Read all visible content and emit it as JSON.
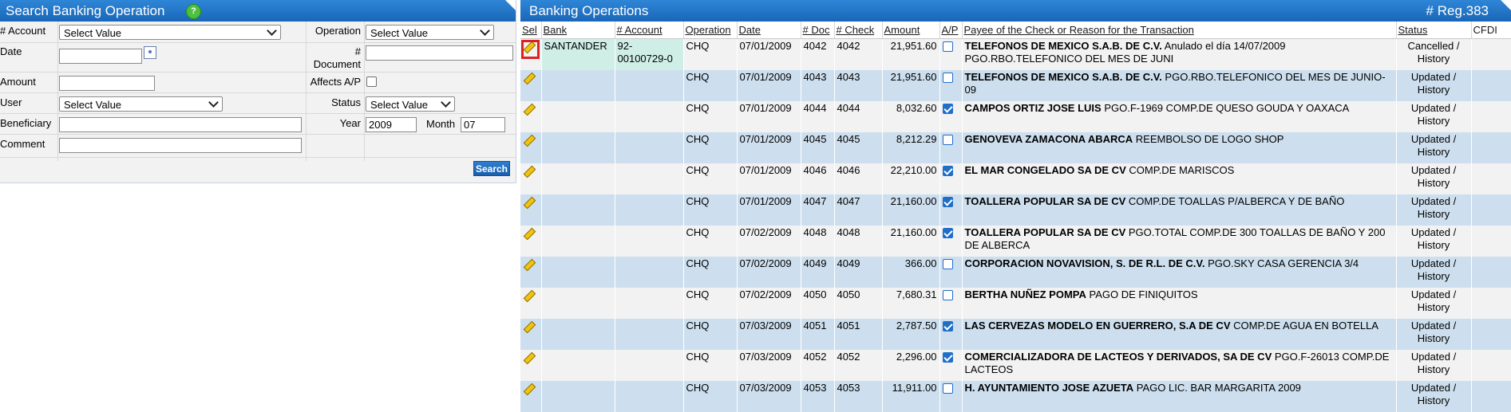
{
  "search": {
    "title": "Search Banking Operation",
    "help_icon": "?",
    "account_label": "# Account",
    "account_value": "Select Value",
    "operation_label": "Operation",
    "operation_value": "Select Value",
    "date_label": "Date",
    "document_label": "# Document",
    "amount_label": "Amount",
    "affects_label": "Affects A/P",
    "user_label": "User",
    "user_value": "Select Value",
    "status_label": "Status",
    "status_value": "Select Value",
    "beneficiary_label": "Beneficiary",
    "year_label": "Year",
    "year_value": "2009",
    "month_label": "Month",
    "month_value": "07",
    "comment_label": "Comment",
    "search_button": "Search"
  },
  "results": {
    "title": "Banking Operations",
    "reg_count": "# Reg.383",
    "columns": {
      "sel": "Sel",
      "bank": "Bank",
      "account": "# Account",
      "operation": "Operation",
      "date": "Date",
      "doc": "# Doc",
      "check": "# Check",
      "amount": "Amount",
      "ap": "A/P",
      "payee": "Payee of the Check or Reason for the Transaction",
      "status": "Status",
      "cfdi": "CFDI"
    },
    "rows": [
      {
        "bank": "SANTANDER",
        "account": "92-00100729-0",
        "operation": "CHQ",
        "date": "07/01/2009",
        "doc": "4042",
        "check": "4042",
        "amount": "21,951.60",
        "ap": false,
        "payee": "TELEFONOS DE MEXICO S.A.B. DE C.V.",
        "reason": "Anulado el día 14/07/2009 PGO.RBO.TELEFONICO DEL MES DE JUNI",
        "status": "Cancelled / History"
      },
      {
        "bank": "",
        "account": "",
        "operation": "CHQ",
        "date": "07/01/2009",
        "doc": "4043",
        "check": "4043",
        "amount": "21,951.60",
        "ap": false,
        "payee": "TELEFONOS DE MEXICO S.A.B. DE C.V.",
        "reason": "PGO.RBO.TELEFONICO DEL MES DE JUNIO-09",
        "status": "Updated / History"
      },
      {
        "bank": "",
        "account": "",
        "operation": "CHQ",
        "date": "07/01/2009",
        "doc": "4044",
        "check": "4044",
        "amount": "8,032.60",
        "ap": true,
        "payee": "CAMPOS ORTIZ JOSE LUIS",
        "reason": "PGO.F-1969 COMP.DE QUESO GOUDA Y OAXACA",
        "status": "Updated / History"
      },
      {
        "bank": "",
        "account": "",
        "operation": "CHQ",
        "date": "07/01/2009",
        "doc": "4045",
        "check": "4045",
        "amount": "8,212.29",
        "ap": false,
        "payee": "GENOVEVA ZAMACONA ABARCA",
        "reason": "REEMBOLSO DE LOGO SHOP",
        "status": "Updated / History"
      },
      {
        "bank": "",
        "account": "",
        "operation": "CHQ",
        "date": "07/01/2009",
        "doc": "4046",
        "check": "4046",
        "amount": "22,210.00",
        "ap": true,
        "payee": "EL MAR CONGELADO SA DE CV",
        "reason": "COMP.DE MARISCOS",
        "status": "Updated / History"
      },
      {
        "bank": "",
        "account": "",
        "operation": "CHQ",
        "date": "07/01/2009",
        "doc": "4047",
        "check": "4047",
        "amount": "21,160.00",
        "ap": true,
        "payee": "TOALLERA POPULAR SA DE CV",
        "reason": "COMP.DE TOALLAS P/ALBERCA Y DE BAÑO",
        "status": "Updated / History"
      },
      {
        "bank": "",
        "account": "",
        "operation": "CHQ",
        "date": "07/02/2009",
        "doc": "4048",
        "check": "4048",
        "amount": "21,160.00",
        "ap": true,
        "payee": "TOALLERA POPULAR SA DE CV",
        "reason": "PGO.TOTAL COMP.DE 300 TOALLAS DE BAÑO Y 200 DE ALBERCA",
        "status": "Updated / History"
      },
      {
        "bank": "",
        "account": "",
        "operation": "CHQ",
        "date": "07/02/2009",
        "doc": "4049",
        "check": "4049",
        "amount": "366.00",
        "ap": false,
        "payee": "CORPORACION NOVAVISION, S. DE R.L. DE C.V.",
        "reason": "PGO.SKY CASA GERENCIA 3/4",
        "status": "Updated / History"
      },
      {
        "bank": "",
        "account": "",
        "operation": "CHQ",
        "date": "07/02/2009",
        "doc": "4050",
        "check": "4050",
        "amount": "7,680.31",
        "ap": false,
        "payee": "BERTHA NUÑEZ POMPA",
        "reason": "PAGO DE FINIQUITOS",
        "status": "Updated / History"
      },
      {
        "bank": "",
        "account": "",
        "operation": "CHQ",
        "date": "07/03/2009",
        "doc": "4051",
        "check": "4051",
        "amount": "2,787.50",
        "ap": true,
        "payee": "LAS CERVEZAS MODELO EN GUERRERO, S.A DE CV",
        "reason": "COMP.DE AGUA EN BOTELLA",
        "status": "Updated / History"
      },
      {
        "bank": "",
        "account": "",
        "operation": "CHQ",
        "date": "07/03/2009",
        "doc": "4052",
        "check": "4052",
        "amount": "2,296.00",
        "ap": true,
        "payee": "COMERCIALIZADORA DE LACTEOS Y DERIVADOS, SA DE CV",
        "reason": "PGO.F-26013 COMP.DE LACTEOS",
        "status": "Updated / History"
      },
      {
        "bank": "",
        "account": "",
        "operation": "CHQ",
        "date": "07/03/2009",
        "doc": "4053",
        "check": "4053",
        "amount": "11,911.00",
        "ap": false,
        "payee": "H. AYUNTAMIENTO JOSE AZUETA",
        "reason": "PAGO LIC. BAR MARGARITA 2009",
        "status": "Updated / History"
      }
    ]
  },
  "colors": {
    "header_blue": "#1966b8",
    "row_odd": "#f2f2f2",
    "row_even": "#cddfee",
    "bank_highlight": "#cfeee6",
    "selection_outline": "#e02020"
  }
}
